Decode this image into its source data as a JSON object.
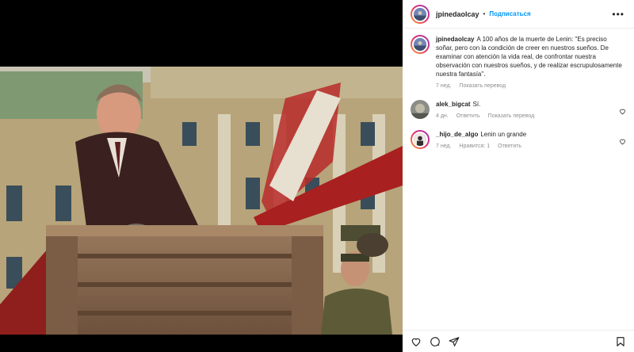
{
  "post": {
    "author": "jpinedaolcay",
    "separator": "•",
    "follow_label": "Подписаться",
    "more_label": "•••",
    "caption": "A 100 años de la muerte de Lenin: \"Es preciso soñar, pero con la condición de creer en nuestros sueños. De examinar con atención la vida real, de confrontar nuestra observación con nuestros sueños, y de realizar escrupulosamente nuestra fantasía\".",
    "caption_time": "7 нед.",
    "translate_label": "Показать перевод"
  },
  "comments": [
    {
      "user": "alek_bigcat",
      "text": "Sí.",
      "time": "4 дн.",
      "reply_label": "Ответить",
      "translate_label": "Показать перевод"
    },
    {
      "user": "_hijo_de_algo",
      "text": "Lenin un grande",
      "time": "7 нед.",
      "likes_label": "Нравится: 1",
      "reply_label": "Ответить"
    }
  ],
  "icons": {
    "like": "heart-icon",
    "comment": "comment-icon",
    "share": "share-icon",
    "save": "bookmark-icon"
  },
  "colors": {
    "link": "#0095f6",
    "text": "#262626",
    "muted": "#8e8e8e"
  }
}
